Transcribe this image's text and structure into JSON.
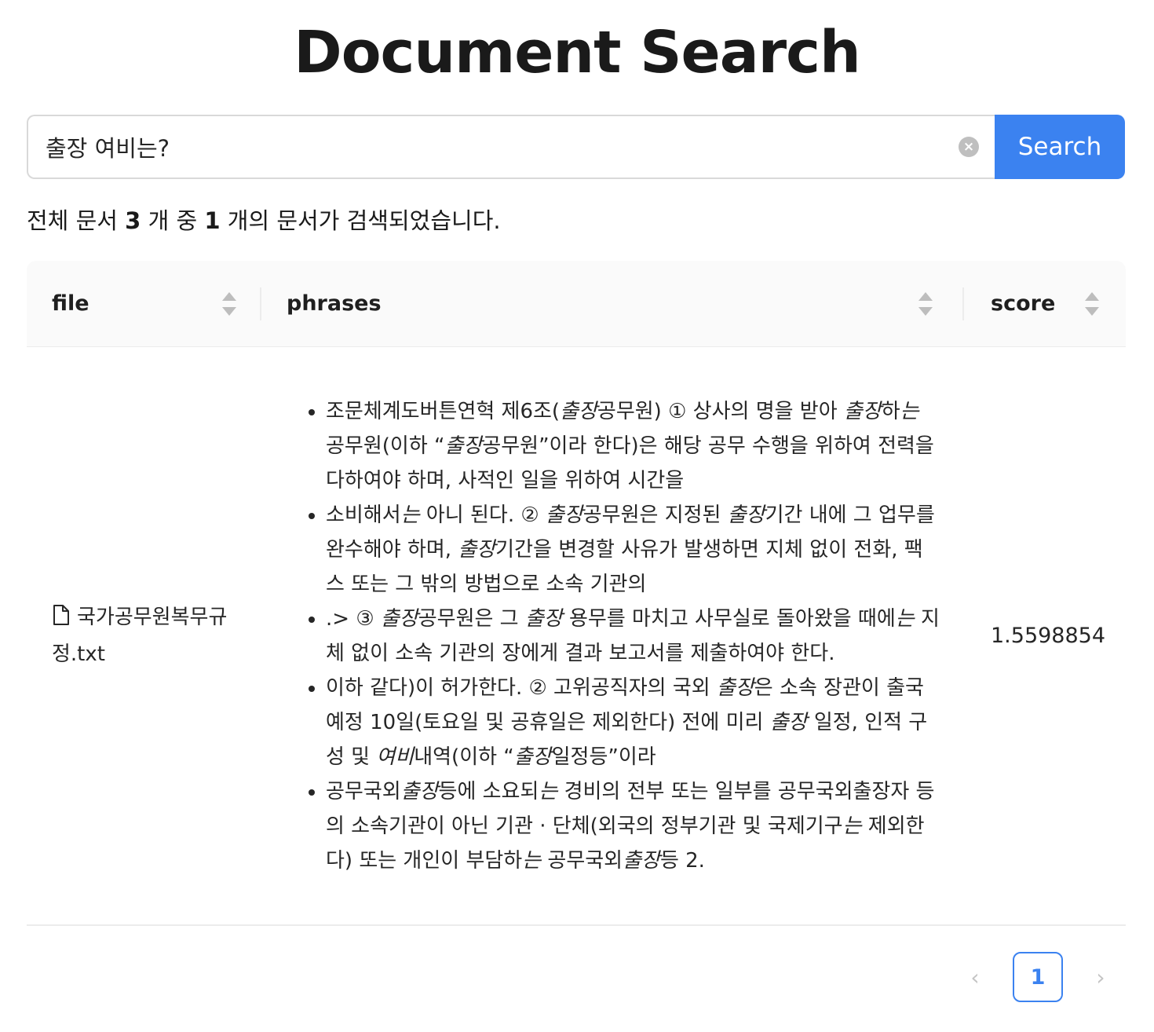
{
  "title": "Document Search",
  "search": {
    "value": "출장 여비는?",
    "button_label": "Search"
  },
  "summary": {
    "prefix": "전체 문서 ",
    "total": "3",
    "middle": " 개 중 ",
    "found": "1",
    "suffix": " 개의 문서가 검색되었습니다."
  },
  "table": {
    "columns": {
      "file": "file",
      "phrases": "phrases",
      "score": "score"
    },
    "rows": [
      {
        "file": "국가공무원복무규정.txt",
        "score": "1.5598854",
        "phrases": [
          [
            {
              "t": "조문체계도버튼연혁 제6조("
            },
            {
              "t": "출장",
              "em": true
            },
            {
              "t": "공무원) ① 상사의 명을 받아 "
            },
            {
              "t": "출장",
              "em": true
            },
            {
              "t": "하"
            },
            {
              "t": "는",
              "em": true
            },
            {
              "t": " 공무원(이하 “"
            },
            {
              "t": "출장",
              "em": true
            },
            {
              "t": "공무원”이라 한다)은 해당 공무 수행을 위하여 전력을 다하여야 하며, 사적인 일을 위하여 시간을"
            }
          ],
          [
            {
              "t": "소비해서"
            },
            {
              "t": "는",
              "em": true
            },
            {
              "t": " 아니 된다. ② "
            },
            {
              "t": "출장",
              "em": true
            },
            {
              "t": "공무원은 지정된 "
            },
            {
              "t": "출장",
              "em": true
            },
            {
              "t": "기간 내에 그 업무를 완수해야 하며, "
            },
            {
              "t": "출장",
              "em": true
            },
            {
              "t": "기간을 변경할 사유가 발생하면 지체 없이 전화, 팩스 또는 그 밖의 방법으로 소속 기관의"
            }
          ],
          [
            {
              "t": ".> ③ "
            },
            {
              "t": "출장",
              "em": true
            },
            {
              "t": "공무원은 그 "
            },
            {
              "t": "출장",
              "em": true
            },
            {
              "t": " 용무를 마치고 사무실로 돌아왔을 때에"
            },
            {
              "t": "는",
              "em": true
            },
            {
              "t": " 지체 없이 소속 기관의 장에게 결과 보고서를 제출하여야 한다."
            }
          ],
          [
            {
              "t": "이하 같다)이 허가한다. ② 고위공직자의 국외 "
            },
            {
              "t": "출장",
              "em": true
            },
            {
              "t": "은 소속 장관이 출국예정 10일(토요일 및 공휴일은 제외한다) 전에 미리 "
            },
            {
              "t": "출장",
              "em": true
            },
            {
              "t": " 일정, 인적 구성 및 "
            },
            {
              "t": "여비",
              "em": true
            },
            {
              "t": "내역(이하 “"
            },
            {
              "t": "출장",
              "em": true
            },
            {
              "t": "일정등”이라"
            }
          ],
          [
            {
              "t": "공무국외"
            },
            {
              "t": "출장",
              "em": true
            },
            {
              "t": "등에 소요되"
            },
            {
              "t": "는",
              "em": true
            },
            {
              "t": " 경비의 전부 또는 일부를 공무국외출장자 등의 소속기관이 아닌 기관 · 단체(외국의 정부기관 및 국제기구"
            },
            {
              "t": "는",
              "em": true
            },
            {
              "t": " 제외한다) 또는 개인이 부담하"
            },
            {
              "t": "는",
              "em": true
            },
            {
              "t": " 공무국외"
            },
            {
              "t": "출장",
              "em": true
            },
            {
              "t": "등 2."
            }
          ]
        ]
      }
    ]
  },
  "pagination": {
    "current": "1",
    "prev_icon": "chevron-left-icon",
    "next_icon": "chevron-right-icon"
  },
  "colors": {
    "accent": "#3b82f0",
    "header_bg": "#fafafa",
    "border": "#d9d9d9"
  }
}
